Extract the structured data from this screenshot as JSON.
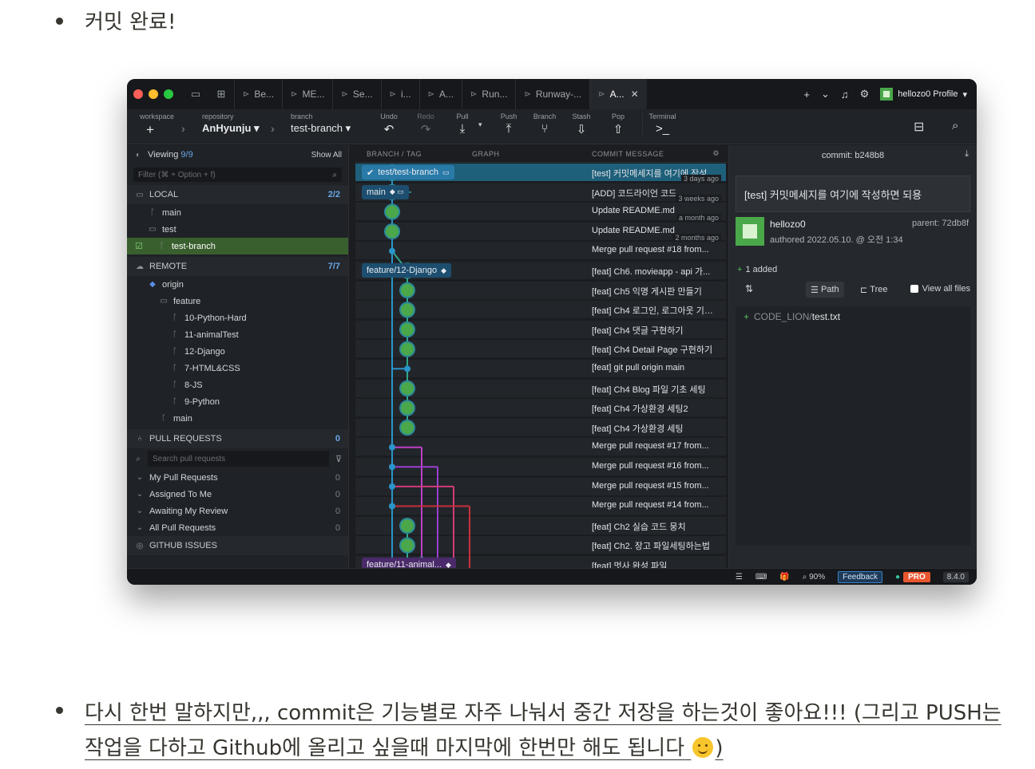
{
  "bullets": {
    "first": "커밋 완료!",
    "second": "다시 한번 말하지만,,, commit은 기능별로 자주 나눠서 중간 저장을 하는것이 좋아요!!!  (그리고 PUSH는 작업을 다하고 Github에 올리고 싶을때 마지막에 한번만 해도 됩니다",
    "second_tail": ")",
    "emoji": "smiling-face-emoji"
  },
  "app": {
    "tabs": [
      {
        "label": "Be..."
      },
      {
        "label": "ME..."
      },
      {
        "label": "Se..."
      },
      {
        "label": "i..."
      },
      {
        "label": "A..."
      },
      {
        "label": "Run..."
      },
      {
        "label": "Runway-..."
      },
      {
        "label": "A...",
        "active": true
      }
    ],
    "profile": "hellozo0 Profile",
    "toolbar": {
      "workspace_label": "workspace",
      "repository_label": "repository",
      "repository": "AnHyunju",
      "branch_label": "branch",
      "branch": "test-branch",
      "buttons": [
        {
          "label": "Undo",
          "icon": "undo-icon"
        },
        {
          "label": "Redo",
          "icon": "redo-icon"
        },
        {
          "label": "Pull",
          "icon": "pull-icon"
        },
        {
          "label": "Push",
          "icon": "push-icon"
        },
        {
          "label": "Branch",
          "icon": "branch-icon"
        },
        {
          "label": "Stash",
          "icon": "stash-icon"
        },
        {
          "label": "Pop",
          "icon": "pop-icon"
        },
        {
          "label": "Terminal",
          "icon": "terminal-icon"
        }
      ]
    },
    "sidebar": {
      "viewing_label": "Viewing",
      "viewing_count": "9/9",
      "show_all": "Show All",
      "filter_placeholder": "Filter (⌘ + Option + f)",
      "local_label": "LOCAL",
      "local_count": "2/2",
      "local_branches": [
        "main",
        "test",
        "test-branch"
      ],
      "remote_label": "REMOTE",
      "remote_count": "7/7",
      "remote_origin": "origin",
      "remote_folder": "feature",
      "remote_branches": [
        "10-Python-Hard",
        "11-animalTest",
        "12-Django",
        "7-HTML&CSS",
        "8-JS",
        "9-Python"
      ],
      "remote_main": "main",
      "pr_label": "PULL REQUESTS",
      "pr_count": "0",
      "pr_search_placeholder": "Search pull requests",
      "pr_groups": [
        {
          "label": "My Pull Requests",
          "count": "0"
        },
        {
          "label": "Assigned To Me",
          "count": "0"
        },
        {
          "label": "Awaiting My Review",
          "count": "0"
        },
        {
          "label": "All Pull Requests",
          "count": "0"
        }
      ],
      "issues_label": "GITHUB ISSUES"
    },
    "graph": {
      "header_branch": "BRANCH / TAG",
      "header_graph": "GRAPH",
      "header_message": "COMMIT MESSAGE",
      "labels": {
        "test_branch": "test/test-branch",
        "main": "main",
        "django": "feature/12-Django",
        "animal": "feature/11-animal..."
      },
      "commits": [
        {
          "msg": "[test] 커밋메세지를 여기에 작성하...",
          "time": "3 days ago"
        },
        {
          "msg": "[ADD] 코드라이언 코드",
          "time": "3 weeks ago"
        },
        {
          "msg": "Update README.md",
          "time": "a month ago"
        },
        {
          "msg": "Update README.md",
          "time": "2 months ago"
        },
        {
          "msg": "Merge pull request #18 from...",
          "time": ""
        },
        {
          "msg": "[feat] Ch6. movieapp - api 가...",
          "time": ""
        },
        {
          "msg": "[feat] Ch5 익명 게시판 만들기",
          "time": ""
        },
        {
          "msg": "[feat] Ch4 로그인, 로그아웃 기능 ...",
          "time": ""
        },
        {
          "msg": "[feat] Ch4 댓글 구현하기",
          "time": ""
        },
        {
          "msg": "[feat] Ch4 Detail Page 구현하기",
          "time": ""
        },
        {
          "msg": "[feat] git pull origin main",
          "time": ""
        },
        {
          "msg": "[feat] Ch4 Blog 파일 기초 세팅",
          "time": ""
        },
        {
          "msg": "[feat] Ch4 가상환경 세팅2",
          "time": ""
        },
        {
          "msg": "[feat] Ch4 가상환경 세팅",
          "time": ""
        },
        {
          "msg": "Merge pull request #17 from...",
          "time": ""
        },
        {
          "msg": "Merge pull request #16 from...",
          "time": ""
        },
        {
          "msg": "Merge pull request #15 from...",
          "time": ""
        },
        {
          "msg": "Merge pull request #14 from...",
          "time": ""
        },
        {
          "msg": "[feat] Ch2 실습 코드 뭉치",
          "time": ""
        },
        {
          "msg": "[feat] Ch2. 장고 파일세팅하는법",
          "time": ""
        },
        {
          "msg": "[feat] 멋사 완성 파일",
          "time": ""
        }
      ]
    },
    "detail": {
      "commit_label": "commit: b248b8",
      "message": "[test] 커밋메세지를 여기에 작성하면 되용",
      "author": "hellozo0",
      "authored": "authored 2022.05.10. @ 오전 1:34",
      "parent": "parent: 72db8f",
      "added": "1 added",
      "path_label": "Path",
      "tree_label": "Tree",
      "view_all_label": "View all files",
      "file_dir": "CODE_LION/",
      "file_name": "test.txt"
    },
    "status": {
      "zoom": "90%",
      "feedback": "Feedback",
      "pro": "PRO",
      "version": "8.4.0"
    }
  }
}
